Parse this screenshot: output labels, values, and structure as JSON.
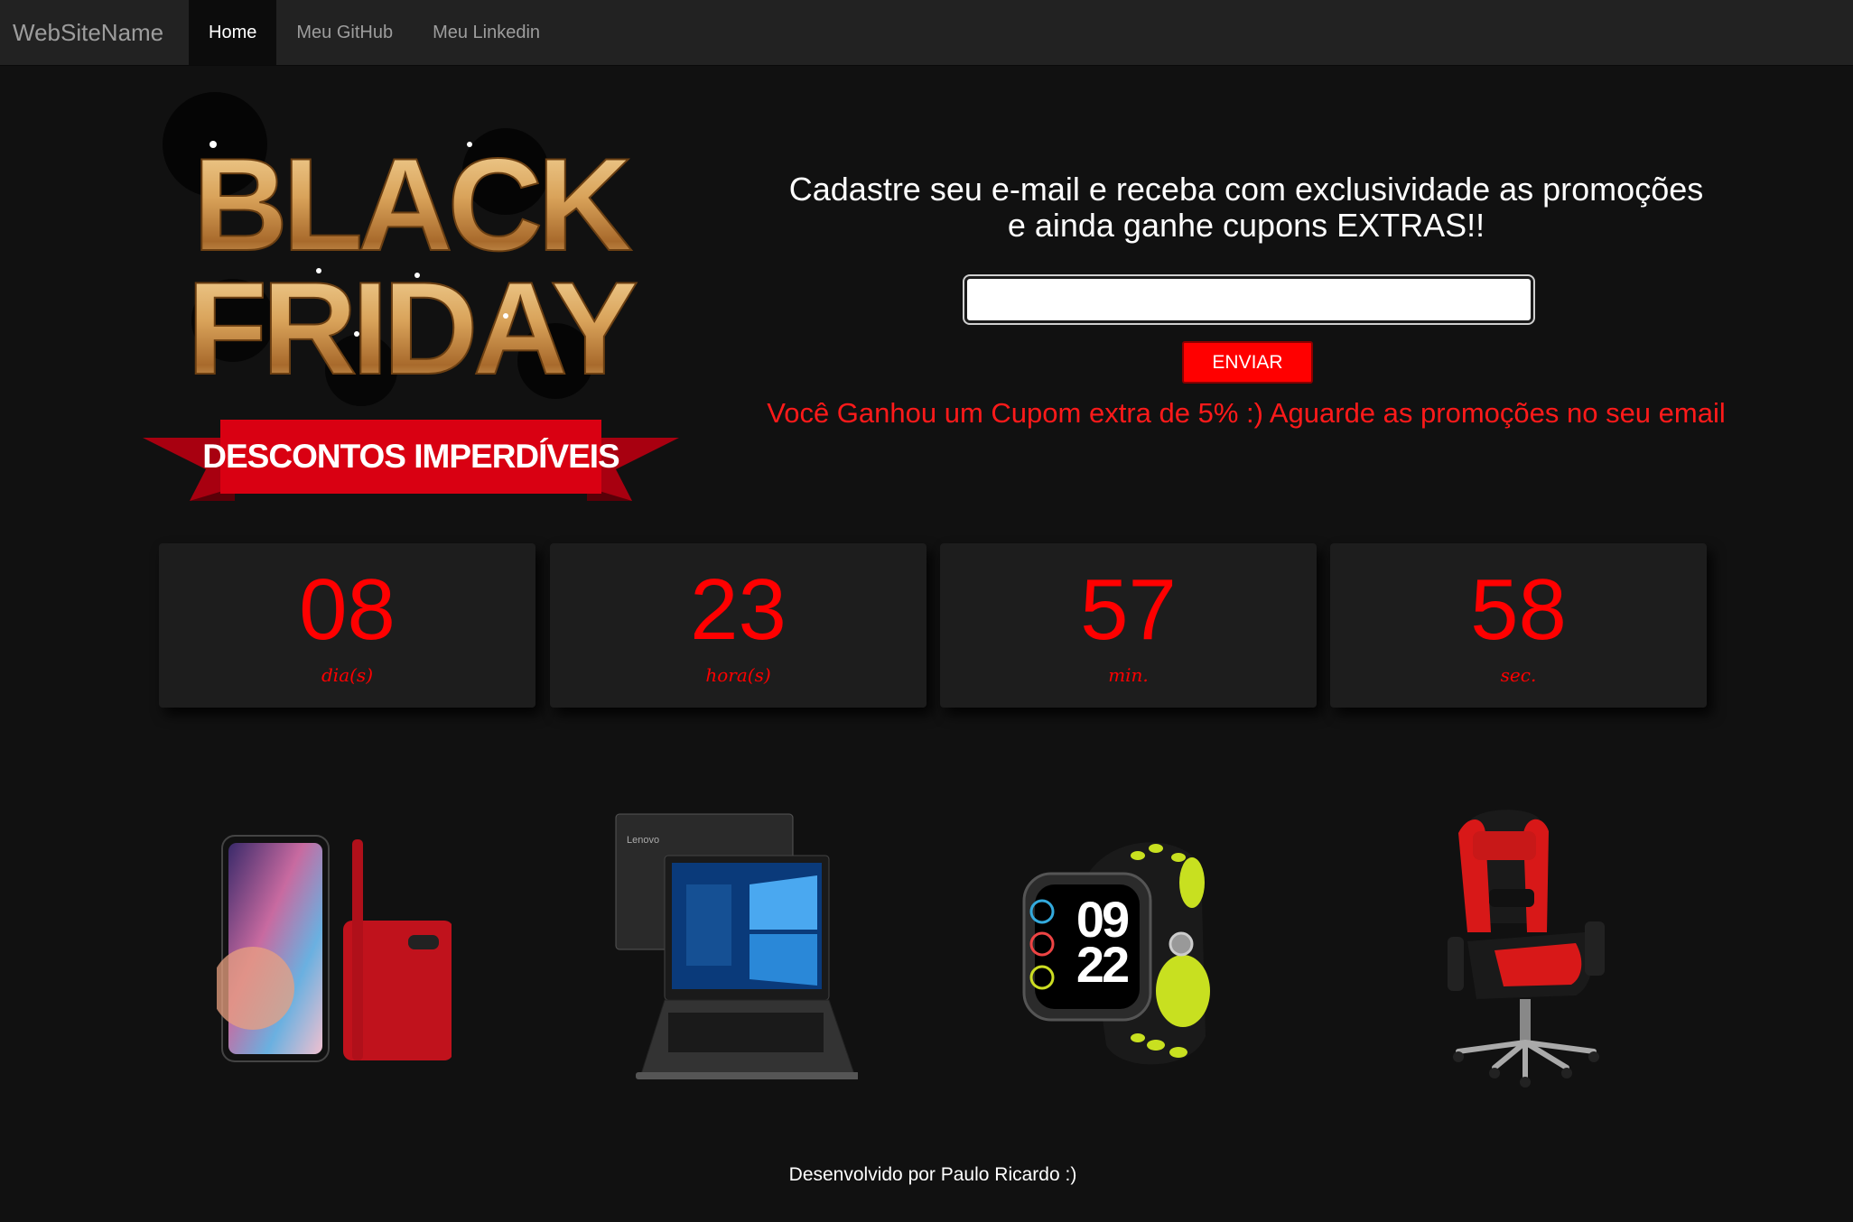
{
  "navbar": {
    "brand": "WebSiteName",
    "items": [
      {
        "label": "Home",
        "active": true
      },
      {
        "label": "Meu GitHub",
        "active": false
      },
      {
        "label": "Meu Linkedin",
        "active": false
      }
    ]
  },
  "hero": {
    "logo_line1": "BLACK",
    "logo_line2": "FRIDAY",
    "ribbon": "DESCONTOS IMPERDÍVEIS"
  },
  "signup": {
    "title_line1": "Cadastre seu e-mail e receba com exclusividade as promoções",
    "title_line2": "e ainda ganhe cupons EXTRAS!!",
    "email_value": "",
    "button_label": "ENVIAR",
    "message": "Você Ganhou um Cupom extra de 5% :) Aguarde as promoções no seu email"
  },
  "countdown": [
    {
      "value": "08",
      "label": "dia(s)"
    },
    {
      "value": "23",
      "label": "hora(s)"
    },
    {
      "value": "57",
      "label": "min."
    },
    {
      "value": "58",
      "label": "sec."
    }
  ],
  "products": {
    "watch_time_hours": "09",
    "watch_time_minutes": "22"
  },
  "footer": {
    "text": "Desenvolvido por Paulo Ricardo :)"
  },
  "colors": {
    "accent": "#ff0000",
    "gold": "#d9a35a",
    "navbar": "#222222",
    "background": "#111111"
  }
}
